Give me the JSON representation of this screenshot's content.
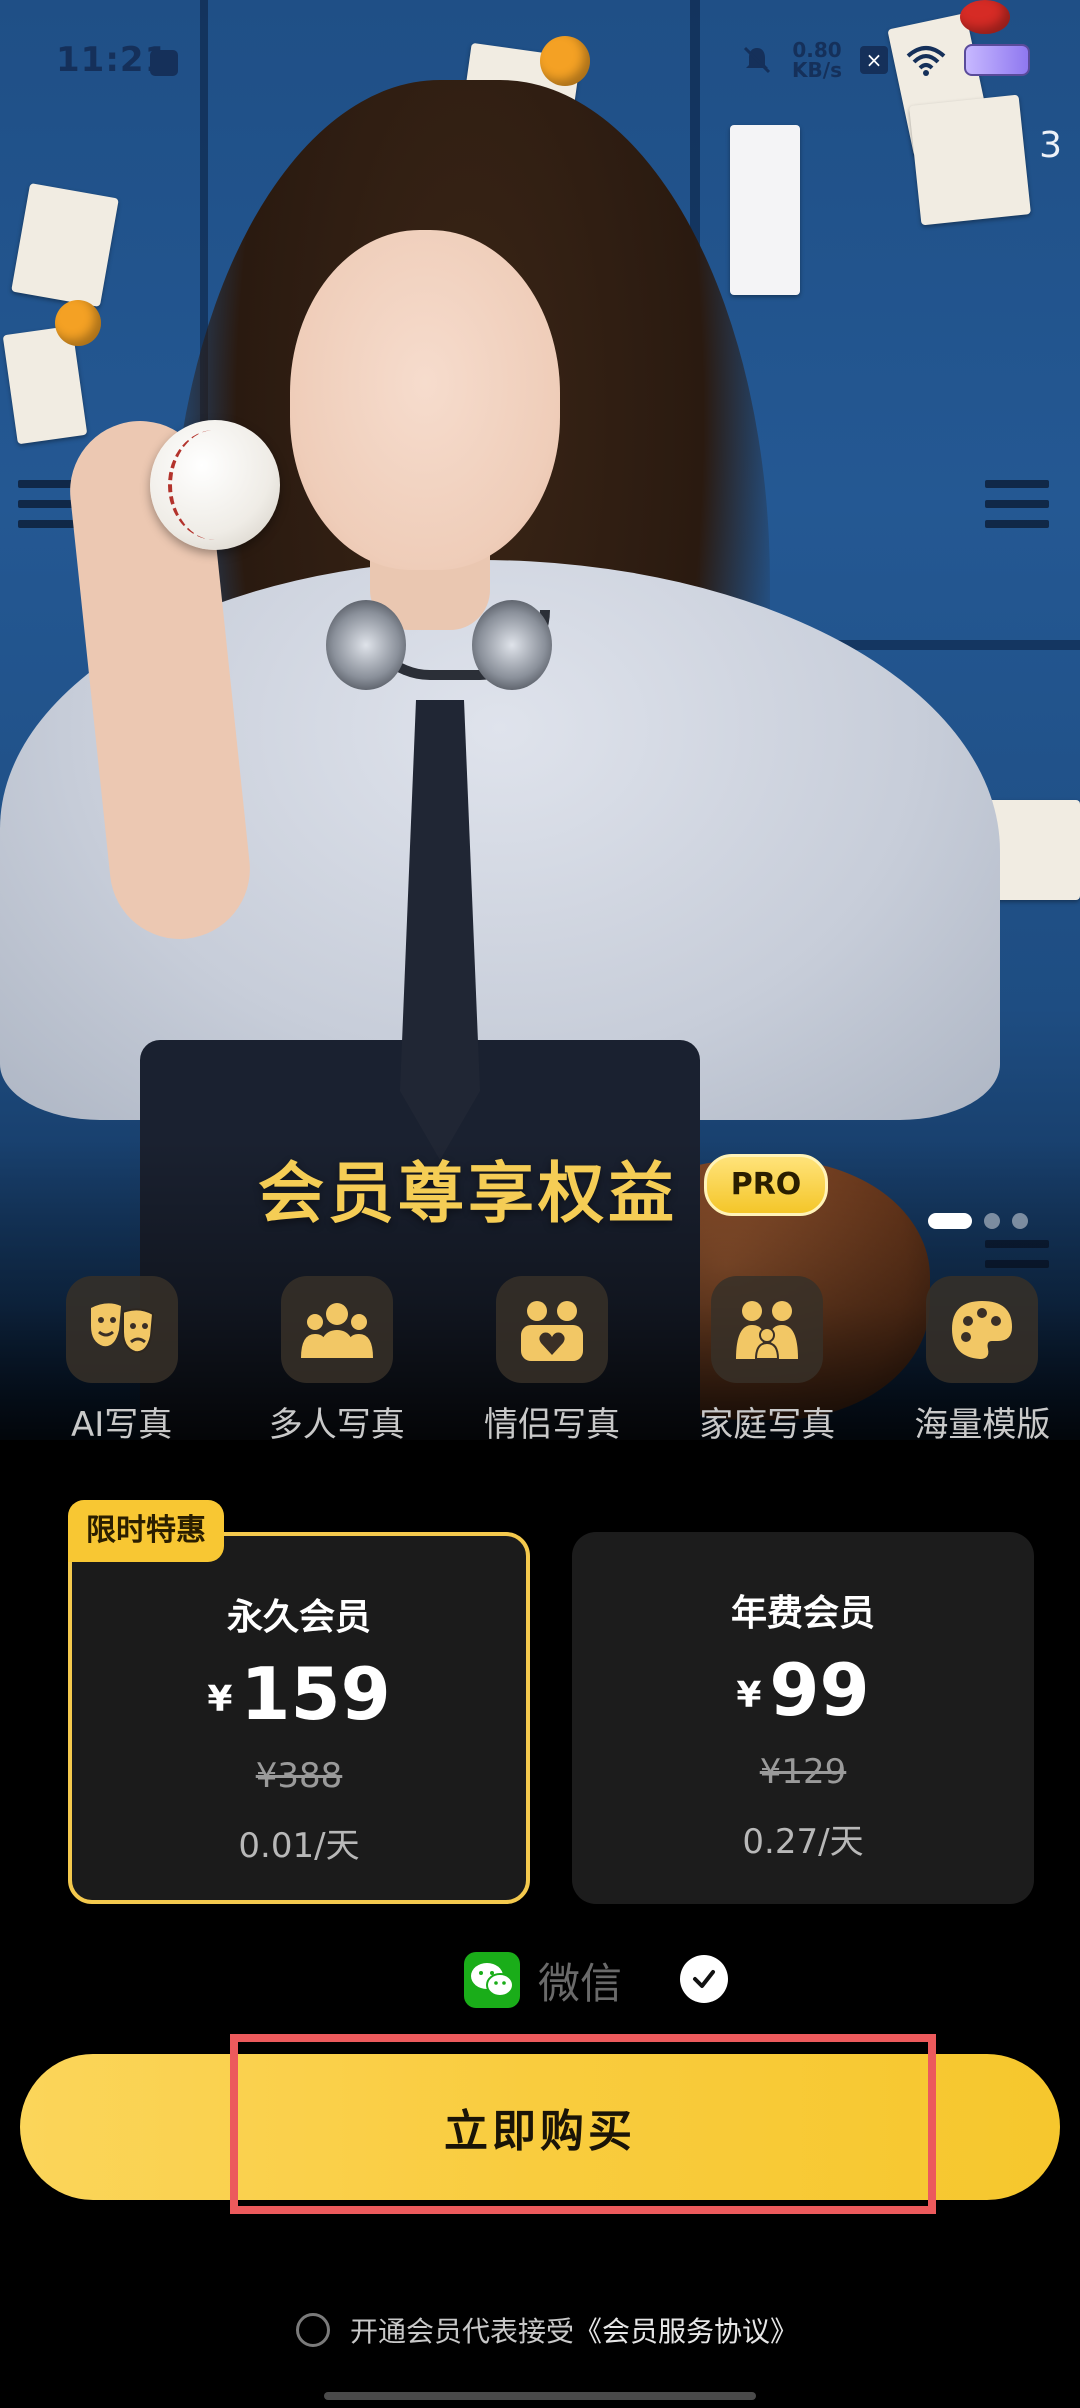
{
  "status_bar": {
    "time": "11:21",
    "net_speed_value": "0.80",
    "net_speed_unit": "KB/s"
  },
  "hero": {
    "page_indicator": "3",
    "title": "会员尊享权益",
    "badge": "PRO",
    "carousel_dots": 3,
    "carousel_active": 0
  },
  "features": [
    {
      "label": "AI写真",
      "icon": "theater-masks-icon"
    },
    {
      "label": "多人写真",
      "icon": "group-icon"
    },
    {
      "label": "情侣写真",
      "icon": "couple-heart-icon"
    },
    {
      "label": "家庭写真",
      "icon": "family-icon"
    },
    {
      "label": "海量模版",
      "icon": "palette-icon"
    }
  ],
  "plans": [
    {
      "tag": "限时特惠",
      "name": "永久会员",
      "currency": "¥",
      "price": "159",
      "original": "¥388",
      "per_day": "0.01/天",
      "selected": true
    },
    {
      "name": "年费会员",
      "currency": "¥",
      "price": "99",
      "original": "¥129",
      "per_day": "0.27/天",
      "selected": false
    }
  ],
  "payment": {
    "method": "微信",
    "selected": true
  },
  "buy_button": "立即购买",
  "agreement": {
    "prefix": "开通会员代表接受",
    "link": "《会员服务协议》"
  },
  "colors": {
    "accent": "#f8c733",
    "background": "#000000",
    "wechat": "#1aad19",
    "highlight_box": "#ec5a5c"
  }
}
